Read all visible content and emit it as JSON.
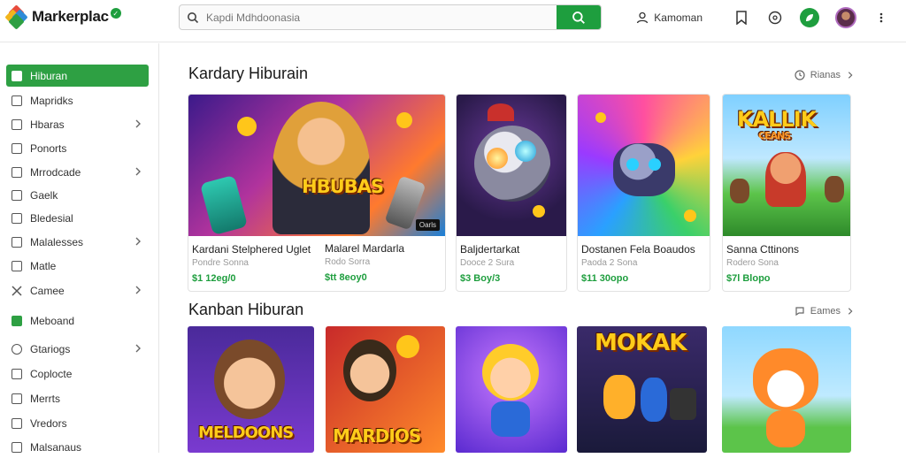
{
  "header": {
    "app_name": "Markerplac",
    "search_placeholder": "Kapdi Mdhdoonasia",
    "user_label": "Kamoman"
  },
  "sidebar": {
    "items": [
      {
        "label": "Hiburan",
        "icon": "check-square-icon",
        "active": true,
        "chevron": false
      },
      {
        "label": "Mapridks",
        "icon": "square-icon",
        "chevron": false
      },
      {
        "label": "Hbaras",
        "icon": "square-icon",
        "chevron": true
      },
      {
        "label": "Ponorts",
        "icon": "square-icon",
        "chevron": false
      },
      {
        "label": "Mrrodcade",
        "icon": "list-icon",
        "chevron": true
      },
      {
        "label": "Gaelk",
        "icon": "square-icon",
        "chevron": false
      },
      {
        "label": "Bledesial",
        "icon": "list-icon",
        "chevron": false
      },
      {
        "label": "Malalesses",
        "icon": "list-icon",
        "chevron": true
      },
      {
        "label": "Matle",
        "icon": "square-icon",
        "chevron": false
      },
      {
        "label": "Camee",
        "icon": "tools-icon",
        "chevron": true
      },
      {
        "label": "Meboand",
        "icon": "check-square-icon",
        "chevron": false
      },
      {
        "label": "Gtariogs",
        "icon": "gear-icon",
        "chevron": true
      },
      {
        "label": "Coplocte",
        "icon": "list-icon",
        "chevron": false
      },
      {
        "label": "Merrts",
        "icon": "list-icon",
        "chevron": false
      },
      {
        "label": "Vredors",
        "icon": "square-icon",
        "chevron": false
      },
      {
        "label": "Malsanaus",
        "icon": "list-icon",
        "chevron": false
      }
    ]
  },
  "sections": [
    {
      "title": "Kardary Hiburain",
      "link": "Rianas",
      "cards": [
        {
          "title": "Kardani Stelphered Uglet",
          "subtitle": "Pondre Sonna",
          "price": "$1 12eg/0",
          "art_text": "HBUBAS",
          "art_tag": "Oarls"
        },
        {
          "title": "Malarel Mardarla",
          "subtitle": "Rodo Sorra",
          "price": "$tt 8eoy0"
        },
        {
          "title": "Baljdertarkat",
          "subtitle": "Dooce 2 Sura",
          "price": "$3 Boy/3"
        },
        {
          "title": "Dostanen Fela Boaudos",
          "subtitle": "Paoda 2 Sona",
          "price": "$11 30opo"
        },
        {
          "title": "Sanna Cttinons",
          "subtitle": "Rodero Sona",
          "price": "$7l Blopo",
          "art_text": "KALLIK",
          "art_sub": "CEANS"
        }
      ]
    },
    {
      "title": "Kanban Hiburan",
      "link": "Eames",
      "thumbs": [
        {
          "art_text": "MELDOONS"
        },
        {
          "art_text": "MARDIOS"
        },
        {
          "art_text": ""
        },
        {
          "art_text": "MOKAK"
        },
        {
          "art_text": ""
        }
      ]
    }
  ]
}
